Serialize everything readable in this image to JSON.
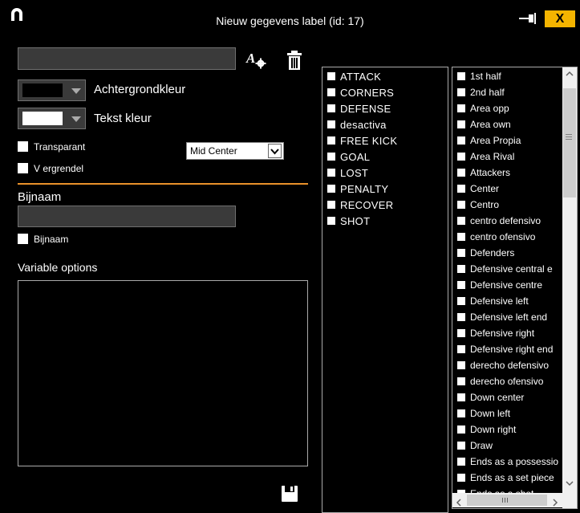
{
  "window": {
    "title": "Nieuw gegevens label (id: 17)",
    "close_label": "X"
  },
  "form": {
    "name_value": "",
    "background_color_label": "Achtergrondkleur",
    "background_color": "#000000",
    "text_color_label": "Tekst kleur",
    "text_color": "#ffffff",
    "transparant_label": "Transparant",
    "vergrendel_label": "V ergrendel",
    "alignment_value": "Mid Center",
    "bijnaam_heading": "Bijnaam",
    "bijnaam_value": "",
    "bijnaam_checkbox_label": "Bijnaam",
    "variable_options_label": "Variable options"
  },
  "colors": {
    "accent_divider": "#e8902a",
    "close_button": "#f4b400"
  },
  "list_categories": [
    "ATTACK",
    "CORNERS",
    "DEFENSE",
    "desactiva",
    "FREE KICK",
    "GOAL",
    "LOST",
    "PENALTY",
    "RECOVER",
    "SHOT"
  ],
  "list_labels": [
    "1st half",
    "2nd half",
    "Area opp",
    "Area own",
    "Area Propia",
    "Area Rival",
    "Attackers",
    "Center",
    "Centro",
    "centro defensivo",
    "centro ofensivo",
    "Defenders",
    "Defensive central e",
    "Defensive centre",
    "Defensive left",
    "Defensive left end",
    "Defensive right",
    "Defensive right end",
    "derecho defensivo",
    "derecho ofensivo",
    "Down center",
    "Down left",
    "Down right",
    "Draw",
    "Ends as a possessio",
    "Ends as a set piece",
    "Ends as a shot"
  ],
  "icons": {
    "logo": "app-logo-icon",
    "pin": "pin-icon",
    "font": "font-settings-icon",
    "delete": "trash-icon",
    "save": "save-icon"
  }
}
